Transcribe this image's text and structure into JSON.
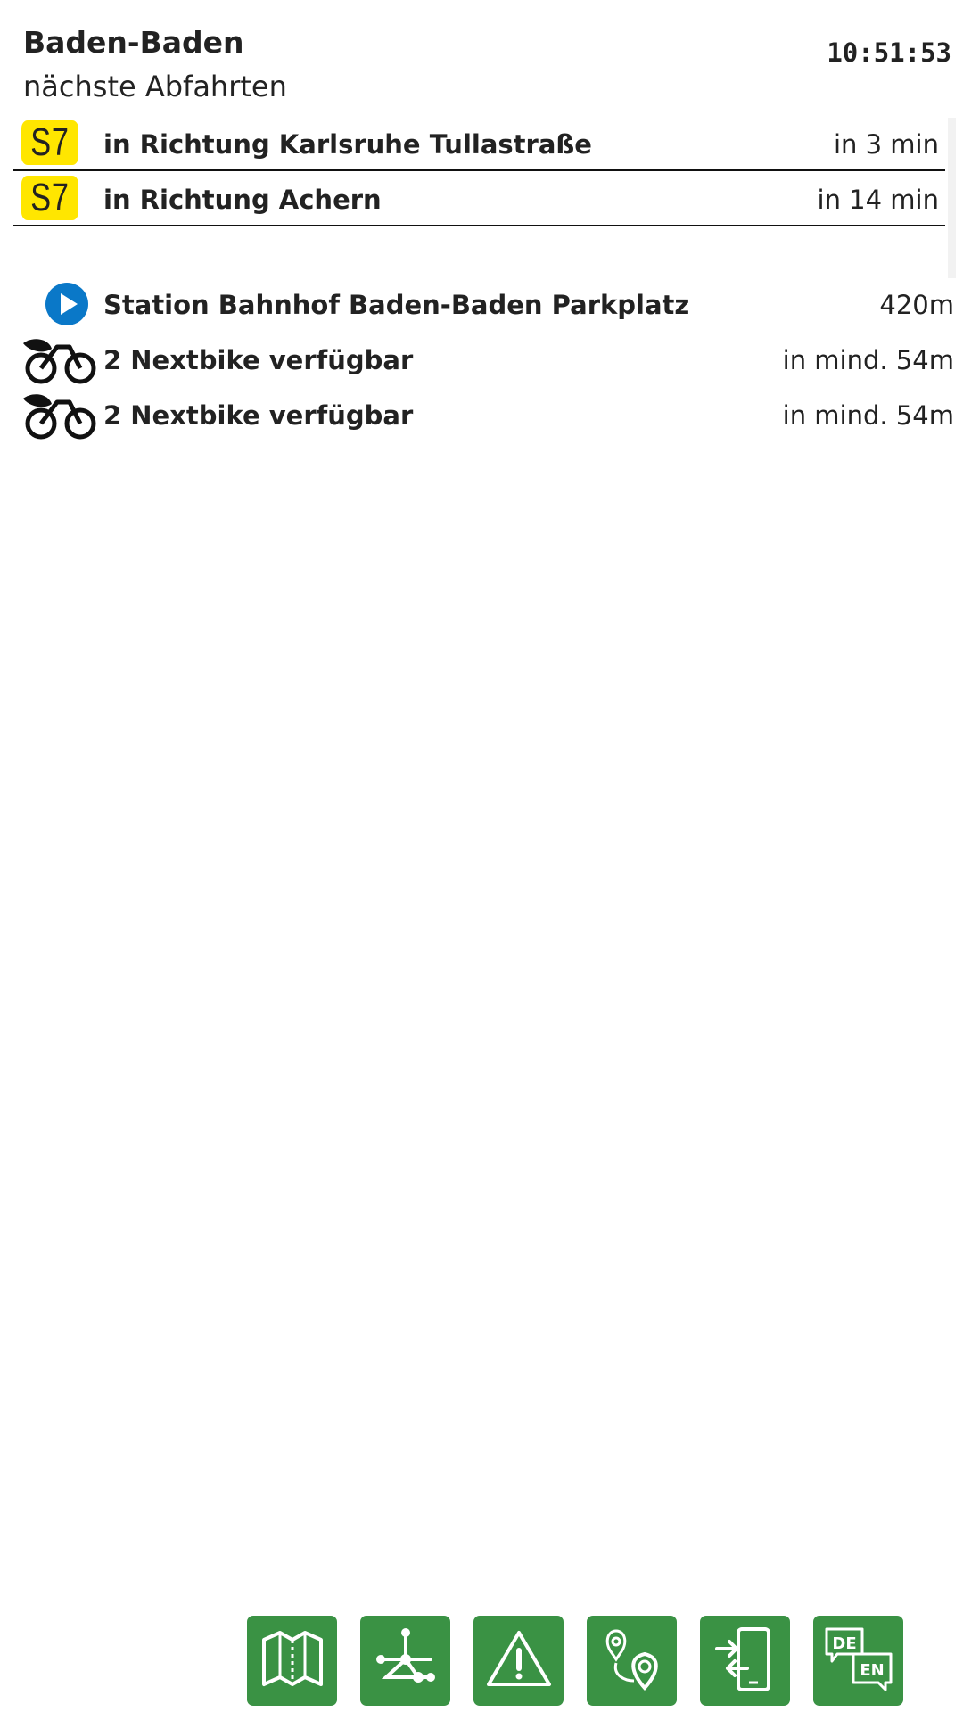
{
  "header": {
    "title": "Baden-Baden",
    "subtitle": "nächste Abfahrten",
    "clock": "10:51:53"
  },
  "departures": [
    {
      "line": "S7",
      "line_color": "#ffe600",
      "direction": "in Richtung Karlsruhe Tullastraße",
      "time": "in 3 min"
    },
    {
      "line": "S7",
      "line_color": "#ffe600",
      "direction": "in Richtung Achern",
      "time": "in 14 min"
    }
  ],
  "mobility": [
    {
      "icon": "play-circle-icon",
      "label": "Station Bahnhof Baden-Baden Parkplatz",
      "distance": "420m"
    },
    {
      "icon": "nextbike-icon",
      "label": "2 Nextbike verfügbar",
      "distance": "in mind. 54m"
    },
    {
      "icon": "nextbike-icon",
      "label": "2 Nextbike verfügbar",
      "distance": "in mind. 54m"
    }
  ],
  "toolbar": {
    "buttons": [
      {
        "icon": "map-icon"
      },
      {
        "icon": "network-icon"
      },
      {
        "icon": "warning-icon"
      },
      {
        "icon": "route-pin-icon"
      },
      {
        "icon": "phone-transfer-icon"
      },
      {
        "icon": "language-switch-icon",
        "label_de": "DE",
        "label_en": "EN"
      }
    ],
    "accent_color": "#3a9244"
  },
  "colors": {
    "station_icon": "#0a78c8",
    "line_badge": "#ffe600"
  }
}
